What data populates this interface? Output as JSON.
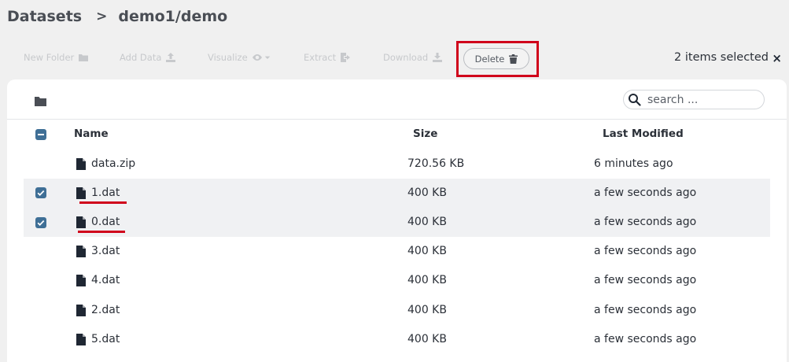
{
  "breadcrumb": {
    "root": "Datasets",
    "separator": ">",
    "path": "demo1/demo"
  },
  "toolbar": {
    "new_folder": "New Folder",
    "add_data": "Add Data",
    "visualize": "Visualize",
    "extract": "Extract",
    "download": "Download",
    "delete": "Delete",
    "selection_status": "2 items selected",
    "clear_selection": "×"
  },
  "search": {
    "placeholder": "search ..."
  },
  "table": {
    "columns": {
      "name": "Name",
      "size": "Size",
      "modified": "Last Modified"
    },
    "rows": [
      {
        "name": "data.zip",
        "size": "720.56 KB",
        "modified": "6 minutes ago",
        "selected": false
      },
      {
        "name": "1.dat",
        "size": "400 KB",
        "modified": "a few seconds ago",
        "selected": true
      },
      {
        "name": "0.dat",
        "size": "400 KB",
        "modified": "a few seconds ago",
        "selected": true
      },
      {
        "name": "3.dat",
        "size": "400 KB",
        "modified": "a few seconds ago",
        "selected": false
      },
      {
        "name": "4.dat",
        "size": "400 KB",
        "modified": "a few seconds ago",
        "selected": false
      },
      {
        "name": "2.dat",
        "size": "400 KB",
        "modified": "a few seconds ago",
        "selected": false
      },
      {
        "name": "5.dat",
        "size": "400 KB",
        "modified": "a few seconds ago",
        "selected": false
      }
    ]
  },
  "colors": {
    "accent": "#3f6f96",
    "highlight": "#d0021b",
    "disabled": "#c7c9cc"
  },
  "icons": [
    "folder-icon",
    "upload-icon",
    "eye-icon",
    "export-icon",
    "download-icon",
    "trash-icon",
    "search-icon",
    "file-icon",
    "checkbox-icon"
  ]
}
